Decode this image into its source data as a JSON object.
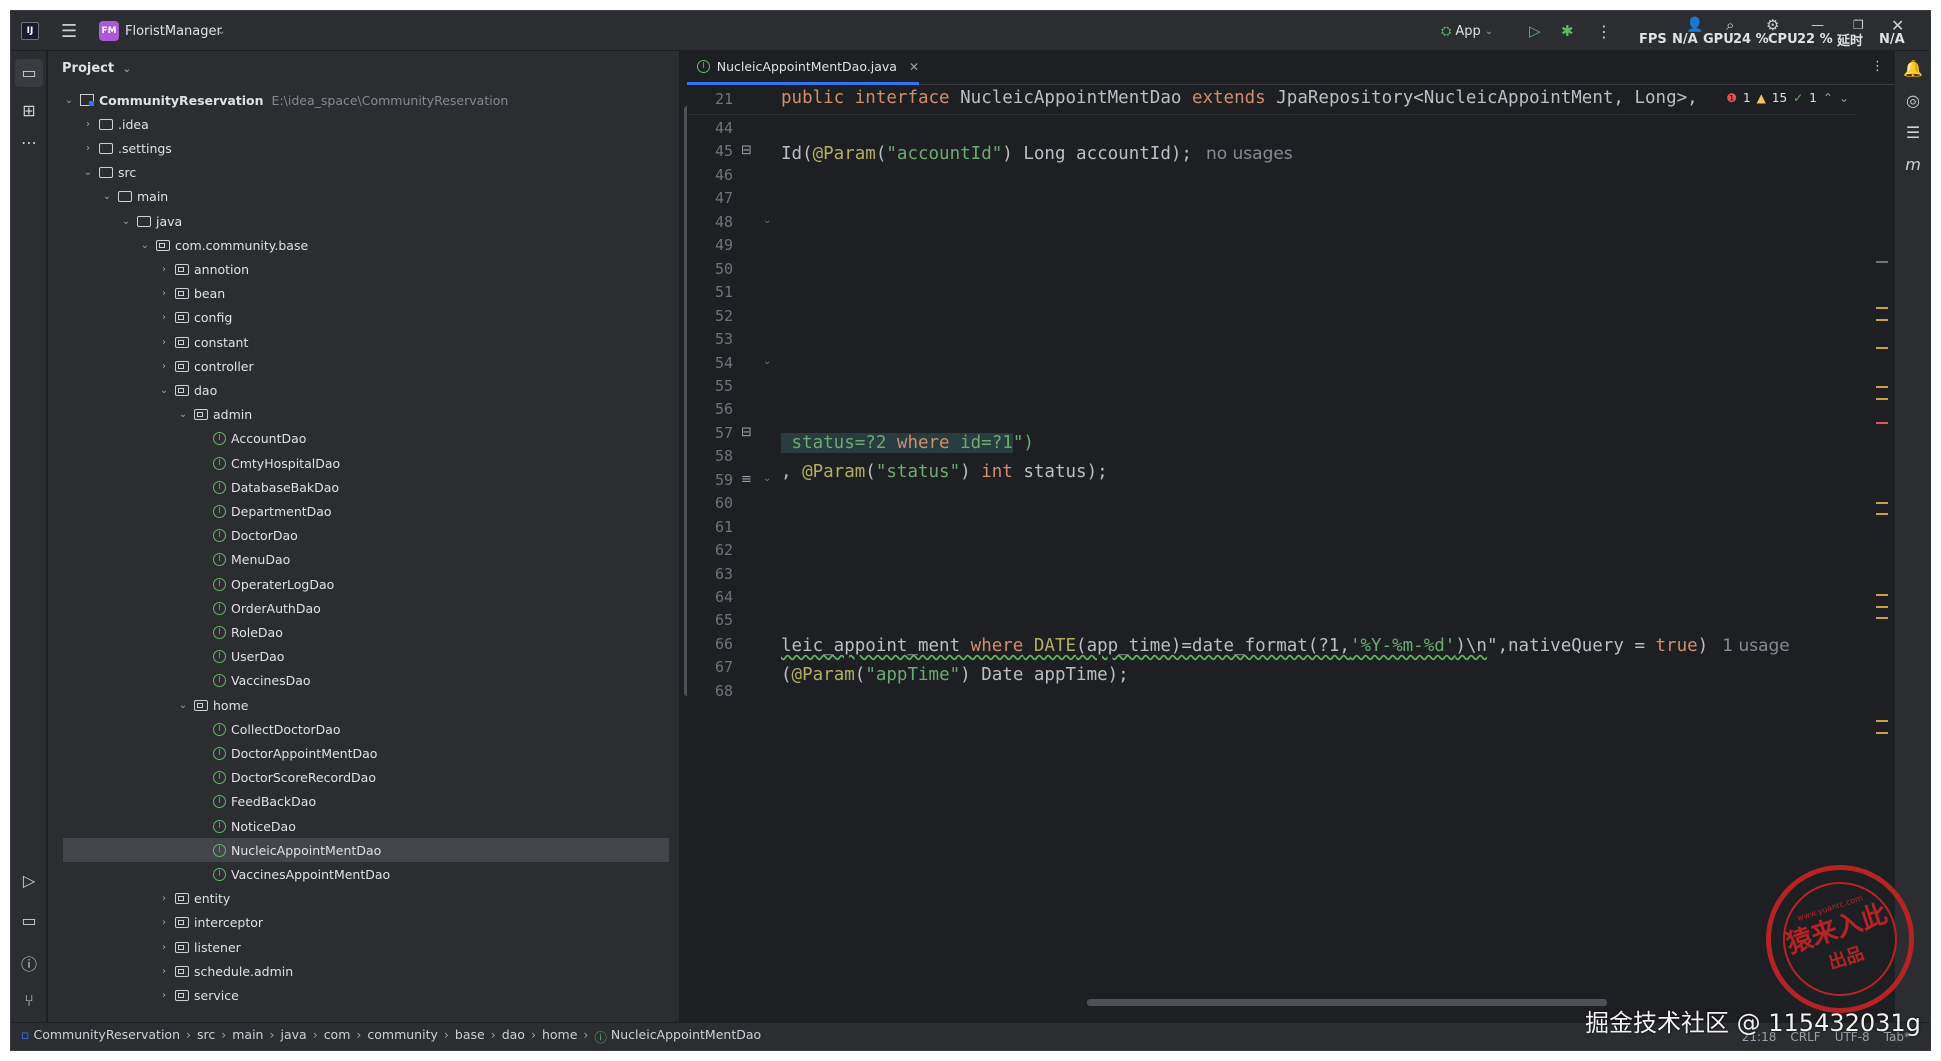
{
  "titlebar": {
    "project_badge": "FM",
    "project_name": "FloristManager",
    "run_config": "App",
    "fps_label": "FPS",
    "fps_value": "N/A",
    "gpu_label": "GPU",
    "gpu_value": "24 %",
    "cpu_label": "CPU",
    "cpu_value": "22 %",
    "latency_label": "延时",
    "latency_value": "N/A"
  },
  "project_panel": {
    "header": "Project",
    "tree": [
      {
        "label": "CommunityReservation",
        "path": "E:\\idea_space\\CommunityReservation",
        "depth": 0,
        "kind": "module",
        "expanded": true
      },
      {
        "label": ".idea",
        "depth": 1,
        "kind": "folder",
        "expanded": false
      },
      {
        "label": ".settings",
        "depth": 1,
        "kind": "folder",
        "expanded": false
      },
      {
        "label": "src",
        "depth": 1,
        "kind": "folder",
        "expanded": true
      },
      {
        "label": "main",
        "depth": 2,
        "kind": "folder",
        "expanded": true
      },
      {
        "label": "java",
        "depth": 3,
        "kind": "folder",
        "expanded": true
      },
      {
        "label": "com.community.base",
        "depth": 4,
        "kind": "package",
        "expanded": true
      },
      {
        "label": "annotion",
        "depth": 5,
        "kind": "package",
        "expanded": false
      },
      {
        "label": "bean",
        "depth": 5,
        "kind": "package",
        "expanded": false
      },
      {
        "label": "config",
        "depth": 5,
        "kind": "package",
        "expanded": false
      },
      {
        "label": "constant",
        "depth": 5,
        "kind": "package",
        "expanded": false
      },
      {
        "label": "controller",
        "depth": 5,
        "kind": "package",
        "expanded": false
      },
      {
        "label": "dao",
        "depth": 5,
        "kind": "package",
        "expanded": true
      },
      {
        "label": "admin",
        "depth": 6,
        "kind": "package",
        "expanded": true
      },
      {
        "label": "AccountDao",
        "depth": 7,
        "kind": "interface"
      },
      {
        "label": "CmtyHospitalDao",
        "depth": 7,
        "kind": "interface"
      },
      {
        "label": "DatabaseBakDao",
        "depth": 7,
        "kind": "interface"
      },
      {
        "label": "DepartmentDao",
        "depth": 7,
        "kind": "interface"
      },
      {
        "label": "DoctorDao",
        "depth": 7,
        "kind": "interface"
      },
      {
        "label": "MenuDao",
        "depth": 7,
        "kind": "interface"
      },
      {
        "label": "OperaterLogDao",
        "depth": 7,
        "kind": "interface"
      },
      {
        "label": "OrderAuthDao",
        "depth": 7,
        "kind": "interface"
      },
      {
        "label": "RoleDao",
        "depth": 7,
        "kind": "interface"
      },
      {
        "label": "UserDao",
        "depth": 7,
        "kind": "interface"
      },
      {
        "label": "VaccinesDao",
        "depth": 7,
        "kind": "interface"
      },
      {
        "label": "home",
        "depth": 6,
        "kind": "package",
        "expanded": true
      },
      {
        "label": "CollectDoctorDao",
        "depth": 7,
        "kind": "interface"
      },
      {
        "label": "DoctorAppointMentDao",
        "depth": 7,
        "kind": "interface"
      },
      {
        "label": "DoctorScoreRecordDao",
        "depth": 7,
        "kind": "interface"
      },
      {
        "label": "FeedBackDao",
        "depth": 7,
        "kind": "interface"
      },
      {
        "label": "NoticeDao",
        "depth": 7,
        "kind": "interface"
      },
      {
        "label": "NucleicAppointMentDao",
        "depth": 7,
        "kind": "interface",
        "selected": true
      },
      {
        "label": "VaccinesAppointMentDao",
        "depth": 7,
        "kind": "interface"
      },
      {
        "label": "entity",
        "depth": 5,
        "kind": "package",
        "expanded": false
      },
      {
        "label": "interceptor",
        "depth": 5,
        "kind": "package",
        "expanded": false
      },
      {
        "label": "listener",
        "depth": 5,
        "kind": "package",
        "expanded": false
      },
      {
        "label": "schedule.admin",
        "depth": 5,
        "kind": "package",
        "expanded": false
      },
      {
        "label": "service",
        "depth": 5,
        "kind": "package",
        "expanded": false
      }
    ]
  },
  "editor": {
    "tab_label": "NucleicAppointMentDao.java",
    "inspections": {
      "errors": "1",
      "warnings": "15",
      "ok": "1"
    },
    "sticky_line_number": "21",
    "line_numbers": [
      "44",
      "45",
      "46",
      "47",
      "48",
      "49",
      "50",
      "51",
      "52",
      "53",
      "54",
      "55",
      "56",
      "57",
      "58",
      "59",
      "60",
      "61",
      "62",
      "63",
      "64",
      "65",
      "66",
      "67",
      "68"
    ],
    "sticky_code": {
      "kw1": "public",
      "kw2": "interface",
      "name": "NucleicAppointMentDao",
      "kw3": "extends",
      "rest": "JpaRepository<NucleicAppointMent, Long>,"
    },
    "line45": {
      "pre": "Id(",
      "ann": "@Param",
      "p1": "(",
      "str": "\"accountId\"",
      "p2": ") Long accountId);",
      "hint": "no usages"
    },
    "line56": {
      "a": " status=?2 ",
      "kw": "where",
      "b": " id=?1",
      "c": "\")"
    },
    "line57": {
      "pre": ", ",
      "ann": "@Param",
      "p1": "(",
      "str": "\"status\"",
      "p2": ") ",
      "kw": "int",
      "p3": " status);"
    },
    "line64": {
      "a": "leic_appoint_ment ",
      "kw": "where",
      "b": " DATE",
      "c": "(app_time)=date_format(?1,",
      "str": "'%Y-%m-%d'",
      "d": ")\\n",
      "e": "\",nativeQuery = ",
      "kw2": "true",
      "f": ")",
      "hint": "1 usage"
    },
    "line65": {
      "pre": "(",
      "ann": "@Param",
      "p1": "(",
      "str": "\"appTime\"",
      "p2": ") Date appTime);"
    }
  },
  "statusbar": {
    "breadcrumbs": [
      "CommunityReservation",
      "src",
      "main",
      "java",
      "com",
      "community",
      "base",
      "dao",
      "home",
      "NucleicAppointMentDao"
    ],
    "position": "21:18",
    "line_sep": "CRLF",
    "encoding": "UTF-8",
    "indent": "Tab*"
  },
  "watermark": {
    "text": "掘金技术社区 @ 115432031g",
    "seal_main": "猿来入此",
    "seal_sub": "出品",
    "seal_url": "www.yuanrc.com"
  }
}
